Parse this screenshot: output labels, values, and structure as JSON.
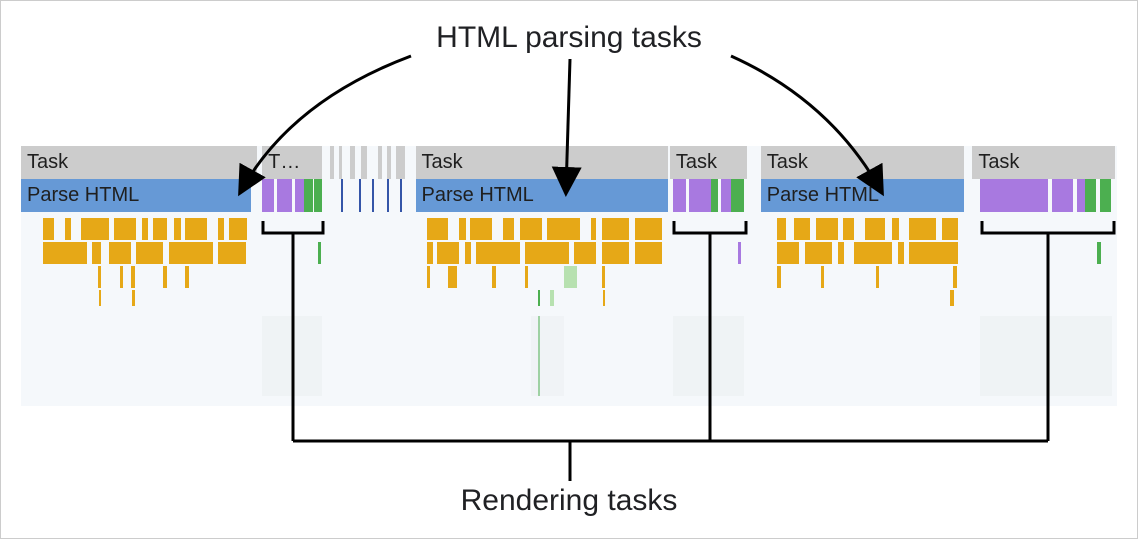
{
  "labels": {
    "top": "HTML parsing tasks",
    "bottom": "Rendering tasks",
    "task": "Task",
    "task_trunc": "T…",
    "parse_html": "Parse HTML"
  },
  "colors": {
    "task_gray": "#cccccc",
    "parse_blue": "#6699d6",
    "render_purple": "#a879e0",
    "render_green": "#4caf50",
    "flame_yellow": "#e6a817",
    "light_green": "#b7e1b0",
    "bg": "#f5f8fb"
  },
  "chart_data": {
    "type": "table",
    "description": "DevTools-style performance flame chart excerpt showing browser main-thread tasks. Three 'Parse HTML' tasks are highlighted with arrows, each followed by a short purple/green render-work cluster labeled 'Rendering tasks'. Below is scripting activity (yellow flame bars).",
    "rows": [
      {
        "lane": "Task",
        "blocks": [
          {
            "label": "Task",
            "x_pct": 0.0,
            "w_pct": 21.5
          },
          {
            "label": "T…",
            "x_pct": 22.0,
            "w_pct": 5.5
          },
          {
            "label": "Task",
            "x_pct": 36.0,
            "w_pct": 23.0
          },
          {
            "label": "Task",
            "x_pct": 59.2,
            "w_pct": 7.0
          },
          {
            "label": "Task",
            "x_pct": 67.5,
            "w_pct": 18.5
          },
          {
            "label": "Task",
            "x_pct": 86.8,
            "w_pct": 13.0
          }
        ]
      },
      {
        "lane": "Parse HTML",
        "blocks": [
          {
            "label": "Parse HTML",
            "x_pct": 0.0,
            "w_pct": 21.0
          },
          {
            "label": "Parse HTML",
            "x_pct": 36.0,
            "w_pct": 23.0
          },
          {
            "label": "Parse HTML",
            "x_pct": 67.5,
            "w_pct": 18.5
          }
        ]
      },
      {
        "lane": "Render clusters (purple/green)",
        "clusters": [
          {
            "x_pct": 22.0,
            "w_pct": 5.5
          },
          {
            "x_pct": 59.5,
            "w_pct": 6.5
          },
          {
            "x_pct": 87.5,
            "w_pct": 12.0
          }
        ]
      }
    ],
    "annotations": {
      "top_arrows_target_lane": "Parse HTML",
      "bottom_brackets_target_lane": "Render clusters"
    }
  }
}
